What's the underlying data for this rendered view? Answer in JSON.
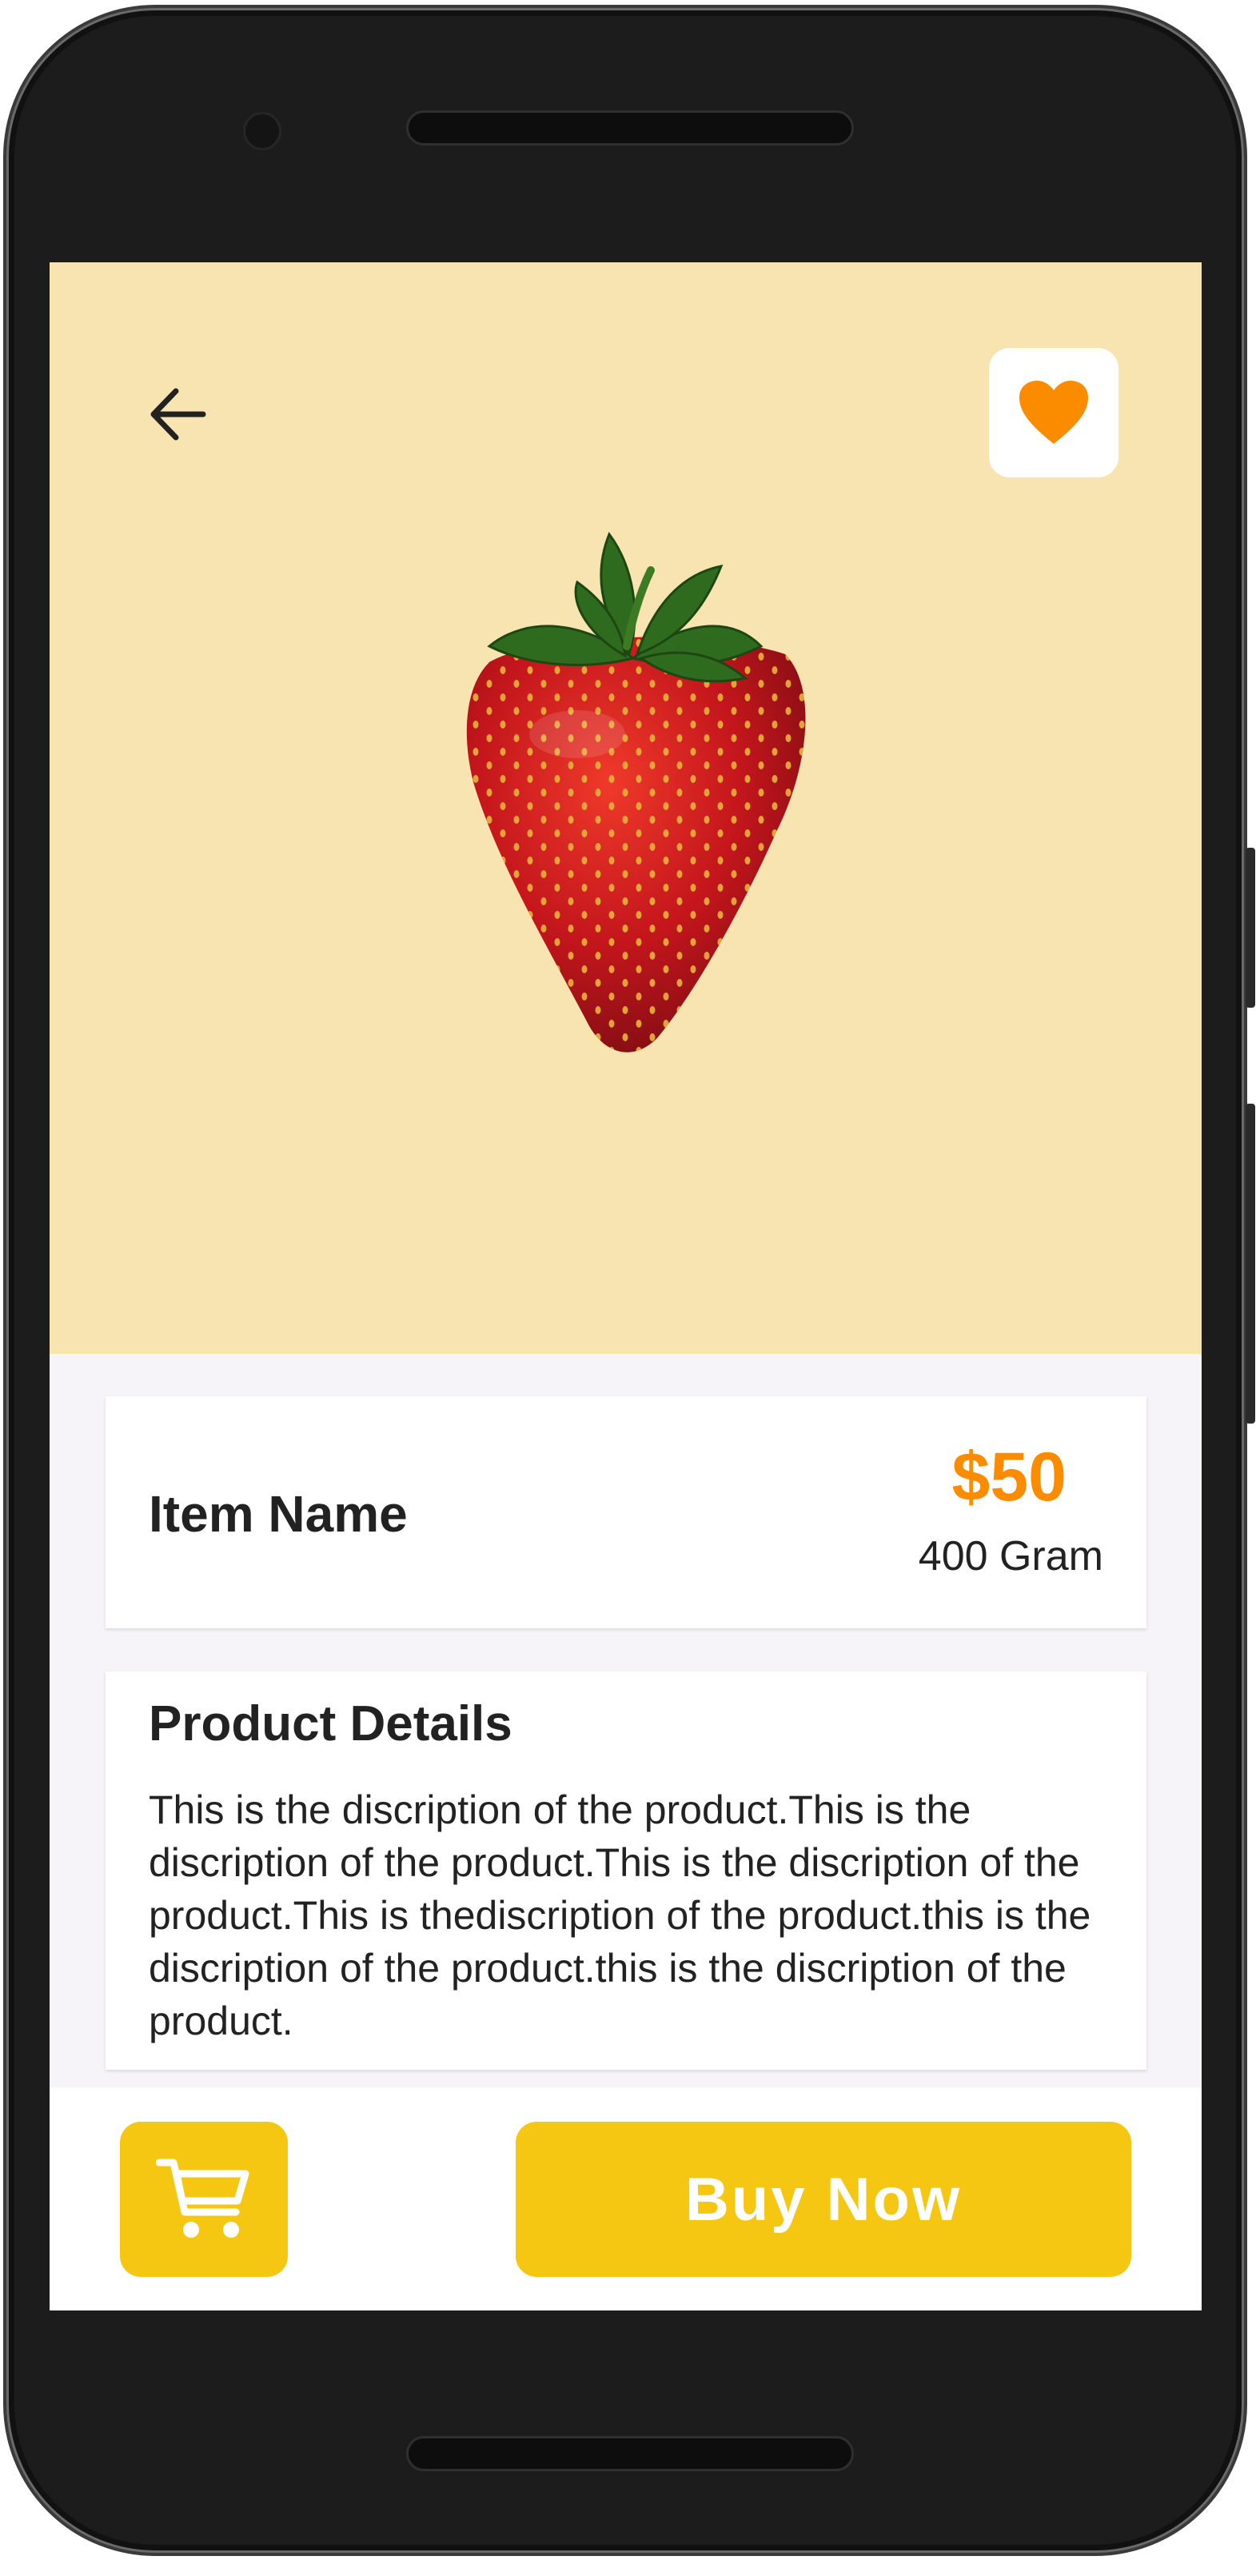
{
  "colors": {
    "hero_bg": "#f8e4b0",
    "accent_orange": "#fb8c00",
    "accent_yellow": "#f5c713",
    "page_bg": "#f6f4f9"
  },
  "header": {
    "back_icon": "arrow-left-icon",
    "favorite_icon": "heart-icon"
  },
  "product": {
    "image": "strawberry-photo",
    "name": "Item Name",
    "price": "$50",
    "weight": "400 Gram"
  },
  "details": {
    "title": "Product Details",
    "body": "This is the discription of the product.This is the discription of the product.This is the discription of the product.This is thediscription of the product.this is the discription of the product.this is the discription of the product."
  },
  "actions": {
    "cart_icon": "shopping-cart-icon",
    "buy_label": "Buy Now"
  }
}
